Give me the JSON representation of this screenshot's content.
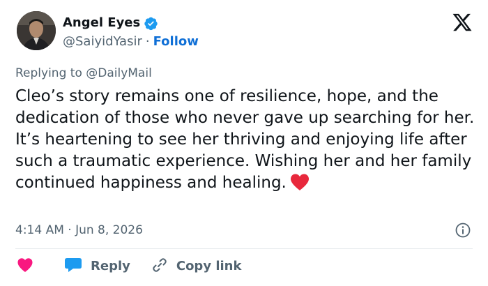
{
  "author": {
    "display_name": "Angel Eyes",
    "handle": "@SaiyidYasir",
    "separator": "·",
    "follow_label": "Follow"
  },
  "tweet": {
    "replying_to": "Replying to @DailyMail",
    "text": "Cleo’s story remains one of resilience, hope, and the dedication of those who never gave up searching for her. It’s heartening to see her thriving and enjoying life after such a traumatic experience. Wishing her and her family continued happiness and healing.",
    "emoji": "red-heart",
    "timestamp": "4:14 AM · Jun 8, 2026"
  },
  "actions": {
    "like_icon": "heart-icon",
    "reply_label": "Reply",
    "copy_link_label": "Copy link"
  },
  "colors": {
    "accent": "#1d9bf0",
    "follow": "#0f6fd6",
    "like": "#f91880",
    "muted": "#536471",
    "text": "#0f1419",
    "heart_emoji": "#e8283c"
  }
}
